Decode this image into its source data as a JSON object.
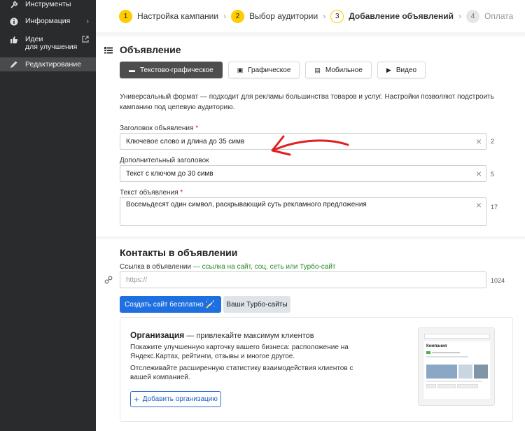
{
  "sidebar": {
    "items": [
      {
        "label": "Инструменты",
        "icon": "wrench-icon"
      },
      {
        "label": "Информация",
        "icon": "info-icon"
      },
      {
        "label_line1": "Идеи",
        "label_line2": "для улучшения",
        "icon": "thumbs-up-icon"
      },
      {
        "label": "Редактирование",
        "icon": "pencil-icon"
      }
    ]
  },
  "stepper": {
    "steps": [
      {
        "num": "1",
        "label": "Настройка кампании"
      },
      {
        "num": "2",
        "label": "Выбор аудитории"
      },
      {
        "num": "3",
        "label": "Добавление объявлений"
      },
      {
        "num": "4",
        "label": "Оплата"
      }
    ]
  },
  "ad": {
    "title": "Объявление",
    "tabs": [
      "Текстово-графическое",
      "Графическое",
      "Мобильное",
      "Видео"
    ],
    "description": "Универсальный формат — подходит для рекламы большинства товаров и услуг. Настройки позволяют подстроить кампанию под целевую аудиторию.",
    "fields": {
      "headline": {
        "label": "Заголовок объявления",
        "value": "Ключевое слово и длина до 35 симв",
        "count": "2"
      },
      "subheadline": {
        "label": "Дополнительный заголовок",
        "value": "Текст с ключом до 30 симв",
        "count": "5"
      },
      "text": {
        "label": "Текст объявления",
        "value": "Восемьдесят один символ, раскрывающий суть рекламного предложения",
        "count": "17"
      }
    }
  },
  "contacts": {
    "title": "Контакты в объявлении",
    "link_label": "Ссылка в объявлении",
    "link_hint": " — ссылка на сайт, соц. сеть или Турбо-сайт",
    "link_placeholder": "https://",
    "link_count": "1024",
    "create_site_button": "Создать сайт бесплатно",
    "turbo_button": "Ваши Турбо-сайты"
  },
  "organization": {
    "title": "Организация",
    "title_suffix": " — привлекайте максимум клиентов",
    "p1": "Покажите улучшенную карточку вашего бизнеса: расположение на Яндекс.Картах, рейтинги, отзывы и многое другое.",
    "p2": "Отслеживайте расширенную статистику взаимодействия клиентов с вашей компанией.",
    "add_button": "Добавить организацию",
    "preview_name": "Компания"
  },
  "colors": {
    "accent_yellow": "#ffcc00",
    "primary_blue": "#1e6fe0",
    "annotation_red": "#e02020"
  }
}
